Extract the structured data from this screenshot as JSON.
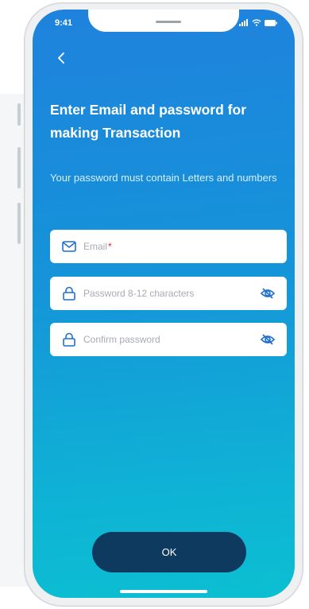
{
  "status_bar": {
    "time": "9:41"
  },
  "header": {
    "back_label": "‹"
  },
  "content": {
    "title": "Enter Email and password for making Transaction",
    "subtitle": "Your password must contain Letters and numbers"
  },
  "form": {
    "email": {
      "placeholder": "Email",
      "required_mark": "*"
    },
    "password": {
      "placeholder": "Password 8-12 characters"
    },
    "confirm": {
      "placeholder": "Confirm password"
    }
  },
  "actions": {
    "ok_label": "OK"
  },
  "colors": {
    "gradient_top": "#1f82dd",
    "gradient_bottom": "#0bbfd2",
    "button": "#0e3a60",
    "icon": "#1f6fd1"
  }
}
